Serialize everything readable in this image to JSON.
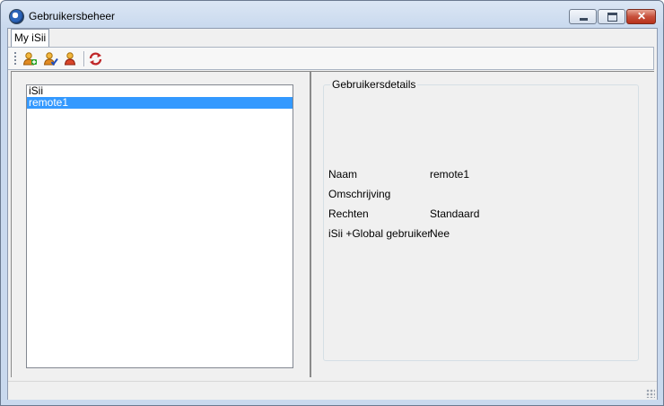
{
  "window": {
    "title": "Gebruikersbeheer"
  },
  "tabs": [
    {
      "label": "My iSii"
    }
  ],
  "toolbar": {
    "buttons": [
      {
        "icon": "add-user-icon"
      },
      {
        "icon": "edit-user-icon"
      },
      {
        "icon": "delete-user-icon"
      },
      {
        "icon": "refresh-icon"
      }
    ]
  },
  "users": {
    "items": [
      {
        "label": "iSii",
        "selected": false
      },
      {
        "label": "remote1",
        "selected": true
      }
    ]
  },
  "details": {
    "title": "Gebruikersdetails",
    "rows": [
      {
        "label": "Naam",
        "value": "remote1"
      },
      {
        "label": "Omschrijving",
        "value": ""
      },
      {
        "label": "Rechten",
        "value": "Standaard"
      },
      {
        "label": "iSii +Global gebruiker",
        "value": "Nee"
      }
    ]
  },
  "colors": {
    "selection": "#3399ff",
    "titlebar": "#c9d9ee",
    "close": "#c7503c"
  }
}
